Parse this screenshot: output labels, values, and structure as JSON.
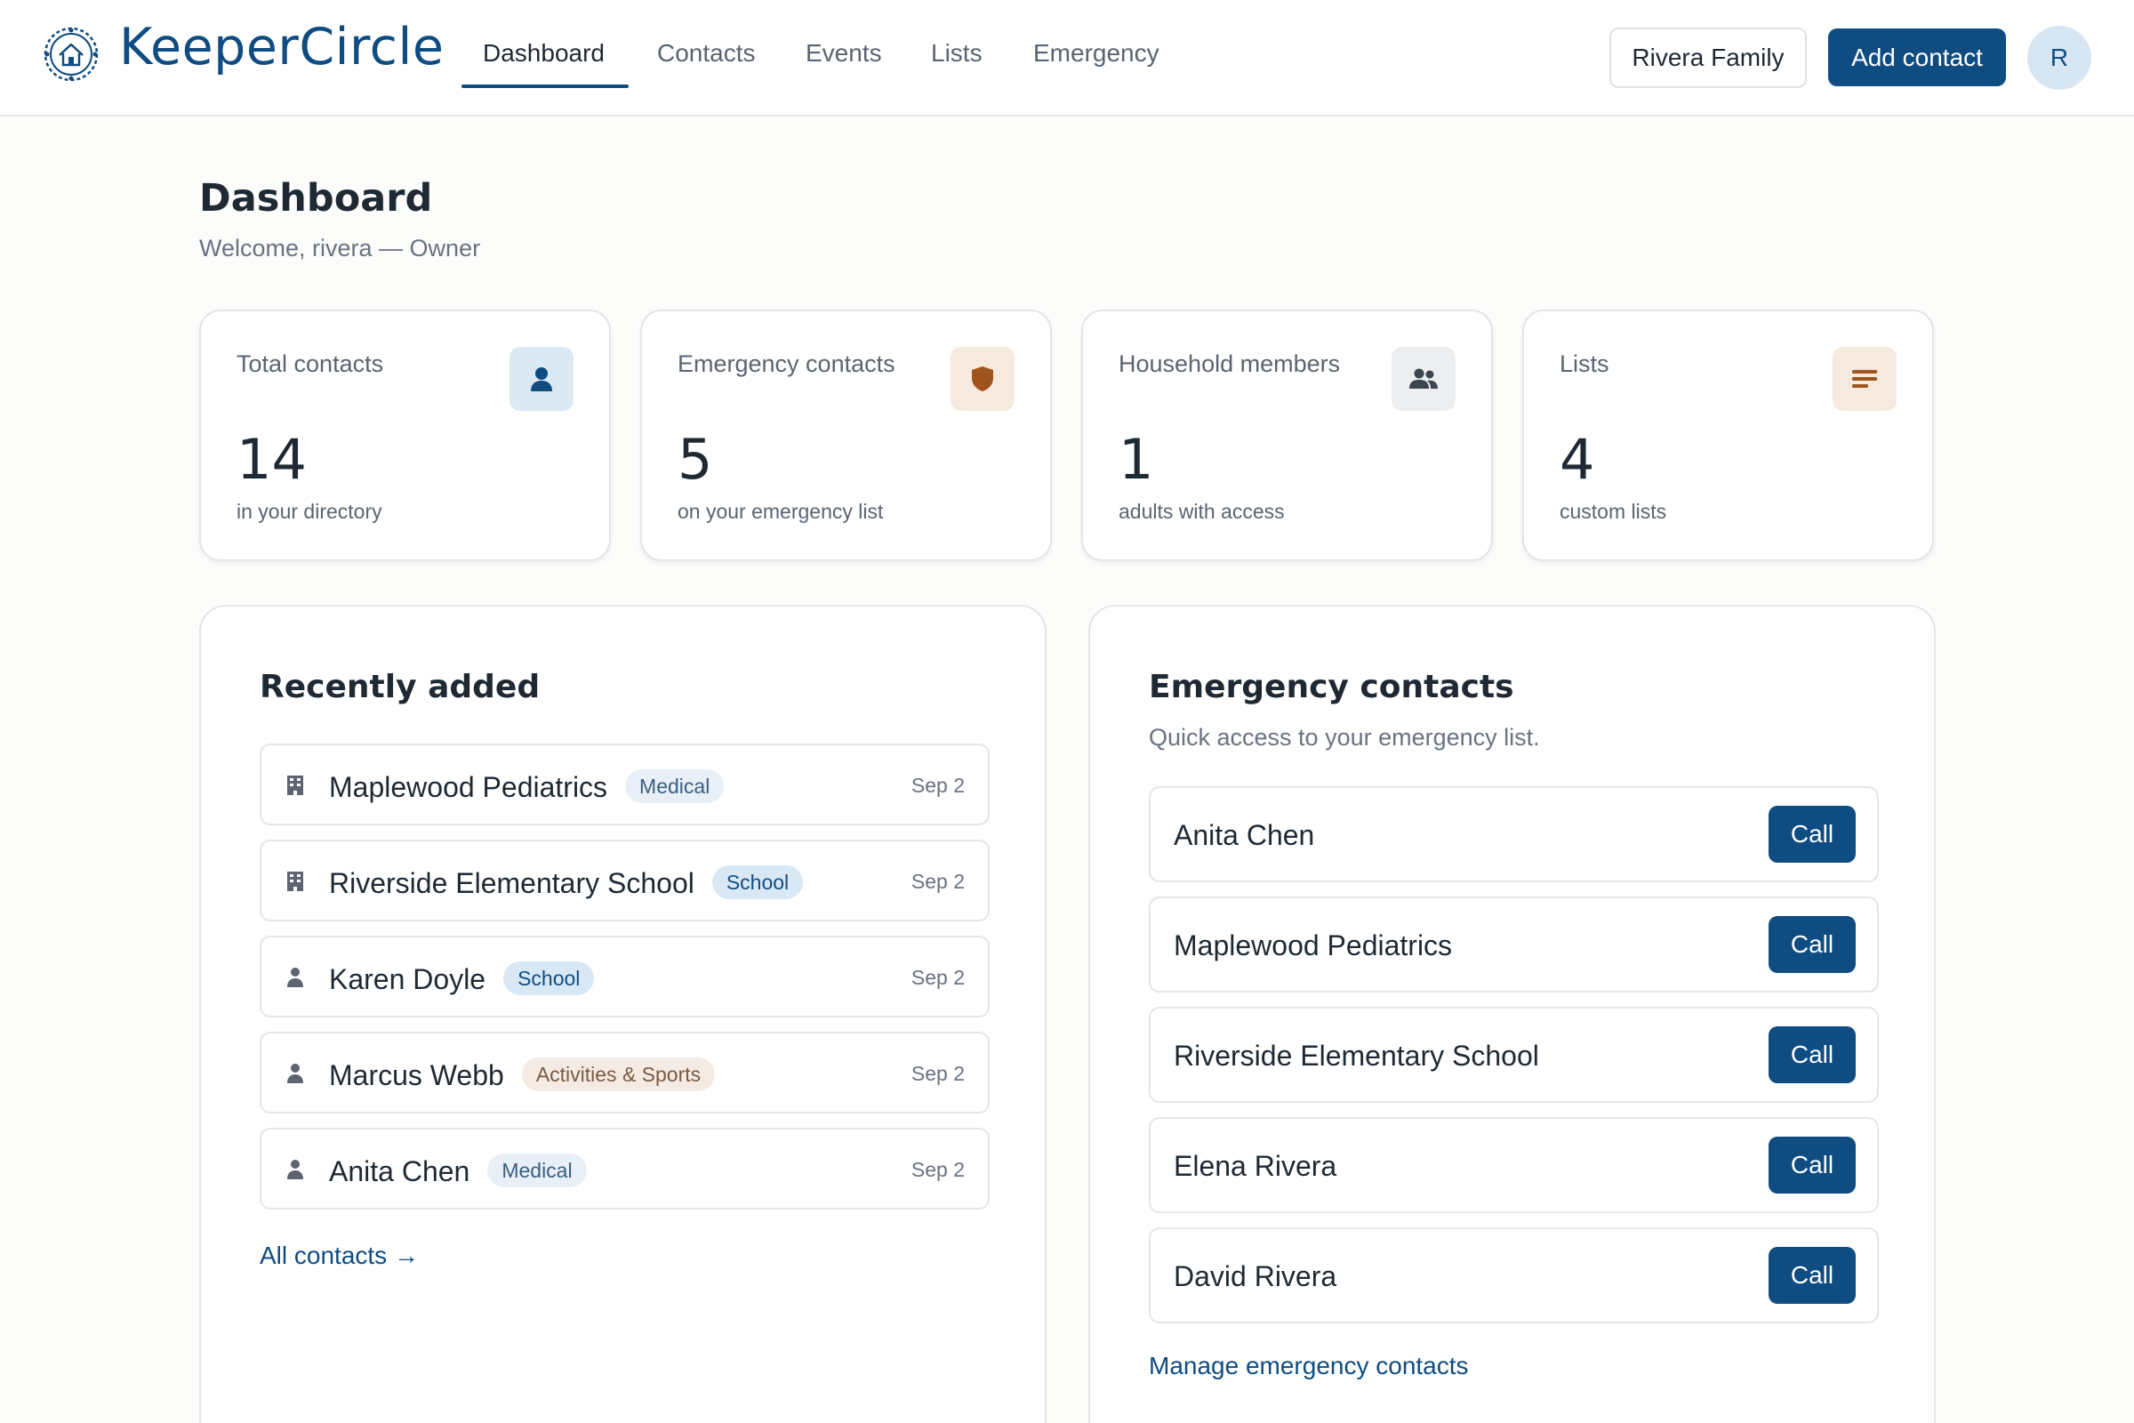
{
  "app": {
    "brand": "KeeperCircle"
  },
  "nav": {
    "items": [
      {
        "label": "Dashboard",
        "active": true
      },
      {
        "label": "Contacts",
        "active": false
      },
      {
        "label": "Events",
        "active": false
      },
      {
        "label": "Lists",
        "active": false
      },
      {
        "label": "Emergency",
        "active": false
      }
    ]
  },
  "header_actions": {
    "household": "Rivera Family",
    "add_contact": "Add contact",
    "avatar_initial": "R"
  },
  "page": {
    "title": "Dashboard",
    "subtitle": "Welcome, rivera — Owner"
  },
  "stats": [
    {
      "label": "Total contacts",
      "value": "14",
      "caption": "in your directory",
      "icon": "person-icon",
      "icon_bg": "#dbe9f5",
      "icon_color": "#0f4c81"
    },
    {
      "label": "Emergency contacts",
      "value": "5",
      "caption": "on your emergency list",
      "icon": "shield-icon",
      "icon_bg": "#f6e9dd",
      "icon_color": "#a0541c"
    },
    {
      "label": "Household members",
      "value": "1",
      "caption": "adults with access",
      "icon": "people-icon",
      "icon_bg": "#eceef0",
      "icon_color": "#3d4550"
    },
    {
      "label": "Lists",
      "value": "4",
      "caption": "custom lists",
      "icon": "list-icon",
      "icon_bg": "#f6e9dd",
      "icon_color": "#a0541c"
    }
  ],
  "recent": {
    "title": "Recently added",
    "items": [
      {
        "name": "Maplewood Pediatrics",
        "tag": "Medical",
        "tag_type": "medical",
        "date": "Sep 2",
        "icon": "building-icon"
      },
      {
        "name": "Riverside Elementary School",
        "tag": "School",
        "tag_type": "school",
        "date": "Sep 2",
        "icon": "building-icon"
      },
      {
        "name": "Karen Doyle",
        "tag": "School",
        "tag_type": "school",
        "date": "Sep 2",
        "icon": "person-icon"
      },
      {
        "name": "Marcus Webb",
        "tag": "Activities & Sports",
        "tag_type": "activities",
        "date": "Sep 2",
        "icon": "person-icon"
      },
      {
        "name": "Anita Chen",
        "tag": "Medical",
        "tag_type": "medical",
        "date": "Sep 2",
        "icon": "person-icon"
      }
    ],
    "link": "All contacts →"
  },
  "emergency": {
    "title": "Emergency contacts",
    "subtitle": "Quick access to your emergency list.",
    "call_label": "Call",
    "items": [
      {
        "name": "Anita Chen"
      },
      {
        "name": "Maplewood Pediatrics"
      },
      {
        "name": "Riverside Elementary School"
      },
      {
        "name": "Elena Rivera"
      },
      {
        "name": "David Rivera"
      }
    ],
    "link": "Manage emergency contacts"
  },
  "colors": {
    "primary": "#0f4c81",
    "text": "#1f2933",
    "muted": "#6b7280",
    "border": "#e3e5e8"
  }
}
